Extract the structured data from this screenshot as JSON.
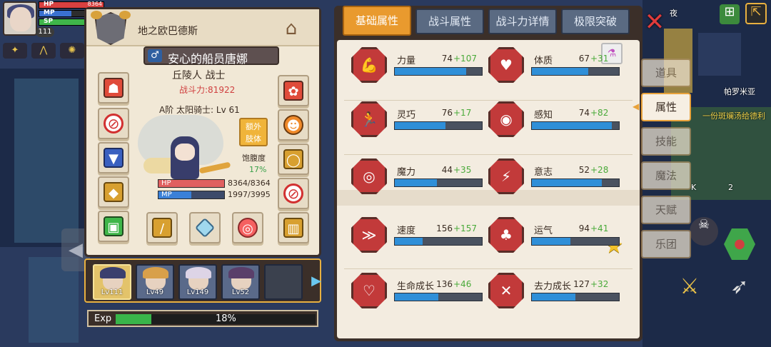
{
  "hud": {
    "level": "111",
    "bars": [
      {
        "label": "HP",
        "value": "8364",
        "fill": 1.0,
        "color": "#d94040"
      },
      {
        "label": "MP",
        "value": "",
        "fill": 0.5,
        "color": "#3a70d0"
      },
      {
        "label": "SP",
        "value": "",
        "fill": 1.0,
        "color": "#3fb64a"
      }
    ]
  },
  "character": {
    "world": "地之欧巴德斯",
    "gender_symbol": "♂",
    "name": "安心的船员唐娜",
    "race_class": "丘陵人 战士",
    "power": "战斗力:81922",
    "title": "A阶 太阳骑士: Lv 61",
    "extra_button": "额外\n肢体",
    "satiety_label": "饱腹度",
    "satiety_value": "17%",
    "hp": {
      "label": "HP",
      "value": "8364/8364",
      "fraction": 1.0
    },
    "mp": {
      "label": "MP",
      "value": "1997/3995",
      "fraction": 0.5
    }
  },
  "party": [
    {
      "level": "Lv111",
      "active": true,
      "hair": "#3a3f6e"
    },
    {
      "level": "Lv49",
      "active": false,
      "hair": "#d8a04a"
    },
    {
      "level": "Lv149",
      "active": false,
      "hair": "#ddd4e6"
    },
    {
      "level": "Lv52",
      "active": false,
      "hair": "#5a3f6a"
    },
    {
      "level": "",
      "active": false,
      "empty": true
    }
  ],
  "exp": {
    "label": "Exp",
    "percent_text": "18%",
    "fraction": 0.18
  },
  "tabs": [
    {
      "label": "基础属性",
      "active": true
    },
    {
      "label": "战斗属性",
      "active": false
    },
    {
      "label": "战斗力详情",
      "active": false
    },
    {
      "label": "极限突破",
      "active": false
    }
  ],
  "attributes": [
    {
      "name": "力量",
      "base": "74",
      "bonus": "+107",
      "fill": 0.82,
      "icon": "arm-icon",
      "glyph": "💪"
    },
    {
      "name": "体质",
      "base": "67",
      "bonus": "+31",
      "fill": 0.65,
      "icon": "body-icon",
      "glyph": "♥"
    },
    {
      "name": "灵巧",
      "base": "76",
      "bonus": "+17",
      "fill": 0.58,
      "icon": "runner-icon",
      "glyph": "🏃"
    },
    {
      "name": "感知",
      "base": "74",
      "bonus": "+82",
      "fill": 0.92,
      "icon": "eye-icon",
      "glyph": "◉"
    },
    {
      "name": "魔力",
      "base": "44",
      "bonus": "+35",
      "fill": 0.48,
      "icon": "spiral-icon",
      "glyph": "◎"
    },
    {
      "name": "意志",
      "base": "52",
      "bonus": "+28",
      "fill": 0.8,
      "icon": "will-icon",
      "glyph": "⚡"
    },
    {
      "name": "速度",
      "base": "156",
      "bonus": "+157",
      "fill": 0.32,
      "icon": "wing-icon",
      "glyph": "≫"
    },
    {
      "name": "运气",
      "base": "94",
      "bonus": "+41",
      "fill": 0.44,
      "icon": "clover-icon",
      "glyph": "♣"
    },
    {
      "name": "生命成长",
      "base": "136",
      "bonus": "+46",
      "fill": 0.5,
      "icon": "life-growth-icon",
      "glyph": "♡"
    },
    {
      "name": "去力成长",
      "base": "127",
      "bonus": "+32",
      "fill": 0.5,
      "icon": "strength-growth-icon",
      "glyph": "✕"
    }
  ],
  "side_tabs": [
    {
      "label": "道具",
      "active": false
    },
    {
      "label": "属性",
      "active": true
    },
    {
      "label": "技能",
      "active": false
    },
    {
      "label": "魔法",
      "active": false
    },
    {
      "label": "天赋",
      "active": false
    },
    {
      "label": "乐团",
      "active": false
    }
  ],
  "map_labels": {
    "place": "帕罗米亚",
    "quest": "一份斑斓汤给德利",
    "night": "夜",
    "count_k": "K",
    "count_two": "2"
  }
}
